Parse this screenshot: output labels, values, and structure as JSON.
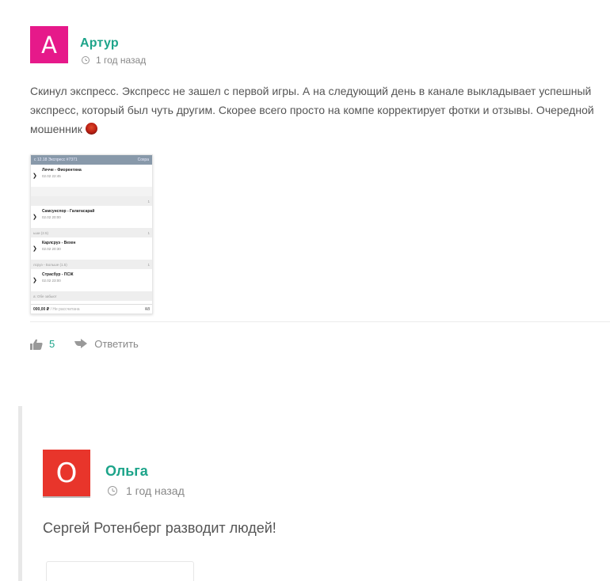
{
  "colors": {
    "accent_green": "#1da48a",
    "avatar_artur_bg": "#e6198a",
    "avatar_olga_bg": "#e8352b"
  },
  "comments": [
    {
      "avatar_letter": "А",
      "author": "Артур",
      "time": "1 год назад",
      "text": "Скинул экспресс. Экспресс не зашел с первой игры. А на следующий день в канале выкладывает успешный экспресс, который был чуть другим. Скорее всего просто на компе корректирует фотки и отзывы. Очередной мошенник",
      "emoji": "angry-face",
      "attachment": {
        "header_left": "с 12.18 Экспресс  #7371",
        "header_right": "Сохра",
        "matches": [
          {
            "name": "Лечче - Фиорентина",
            "date": "02.02 22:45",
            "bet_label": "",
            "bet_value": "1"
          },
          {
            "name": "Самсунспор - Галатасарай",
            "date": "02.02 20:00",
            "bet_label": "ьши (2.5)",
            "bet_value": "1"
          },
          {
            "name": "Карлсруэ - Вехен",
            "date": "02.02 20:30",
            "bet_label": "лсруэ - Больше (1.5)",
            "bet_value": "1"
          },
          {
            "name": "Страсбур - ПСЖ",
            "date": "02.02 23:00",
            "bet_label": "а: Обе забьют",
            "bet_value": ""
          }
        ],
        "footer_amount": "000,00 ₽",
        "footer_status": "/ Не рассчитана",
        "footer_right": "Кő"
      },
      "likes": "5",
      "reply_label": "Ответить"
    },
    {
      "avatar_letter": "О",
      "author": "Ольга",
      "time": "1 год назад",
      "text": "Сергей Ротенберг разводит людей!"
    }
  ]
}
